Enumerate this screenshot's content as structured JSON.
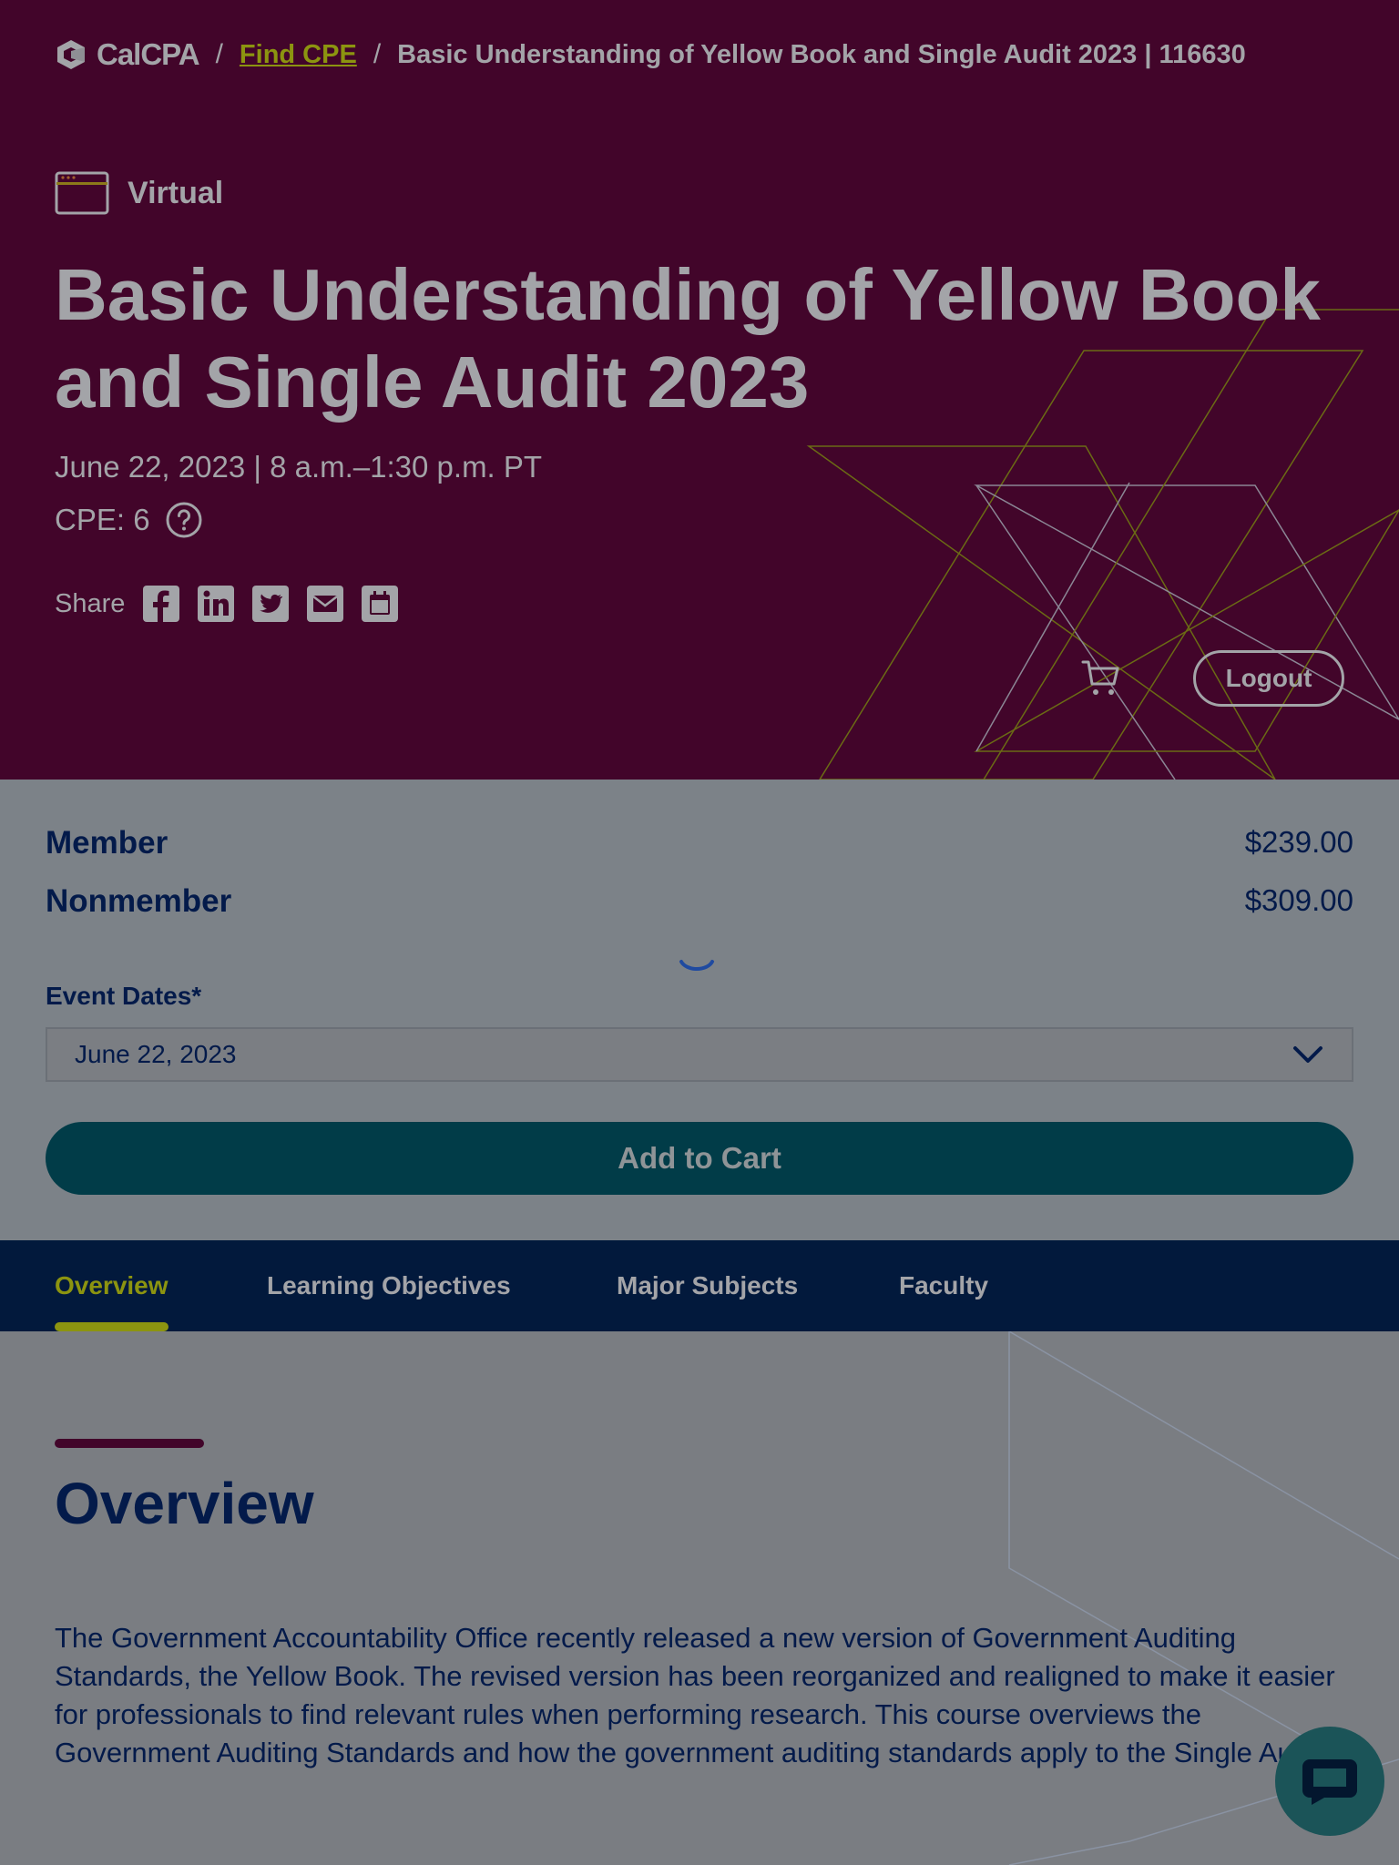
{
  "breadcrumb": {
    "logo_text": "CalCPA",
    "separator": "/",
    "link_label": "Find CPE",
    "current": "Basic Understanding of Yellow Book and Single Audit 2023 | 116630"
  },
  "event": {
    "format": "Virtual",
    "title": "Basic Understanding of Yellow Book and Single Audit 2023",
    "date_time": "June 22, 2023 | 8 a.m.–1:30 p.m. PT",
    "cpe": "CPE: 6",
    "share_label": "Share",
    "share_icons": [
      "facebook-icon",
      "linkedin-icon",
      "twitter-icon",
      "email-icon",
      "calendar-icon"
    ]
  },
  "header_actions": {
    "logout_label": "Logout"
  },
  "pricing": {
    "rows": [
      {
        "label": "Member",
        "price": "$239.00"
      },
      {
        "label": "Nonmember",
        "price": "$309.00"
      }
    ],
    "event_dates_label": "Event Dates*",
    "selected_date": "June 22, 2023",
    "add_to_cart_label": "Add to Cart"
  },
  "tabs": [
    {
      "label": "Overview",
      "active": true
    },
    {
      "label": "Learning Objectives",
      "active": false
    },
    {
      "label": "Major Subjects",
      "active": false
    },
    {
      "label": "Faculty",
      "active": false
    }
  ],
  "overview": {
    "heading": "Overview",
    "body": "The Government Accountability Office recently released a new version of Government Auditing Standards, the Yellow Book. The revised version has been reorganized and realigned to make it easier for professionals to find relevant rules when performing research. This course overviews the Government Auditing Standards and how the government auditing standards apply to the Single Audit."
  },
  "colors": {
    "hero_bg": "#42052a",
    "accent_olive": "#8c9410",
    "navy": "#02193c",
    "teal_button": "#013c48",
    "overlay_gray": "#7a7d82"
  }
}
